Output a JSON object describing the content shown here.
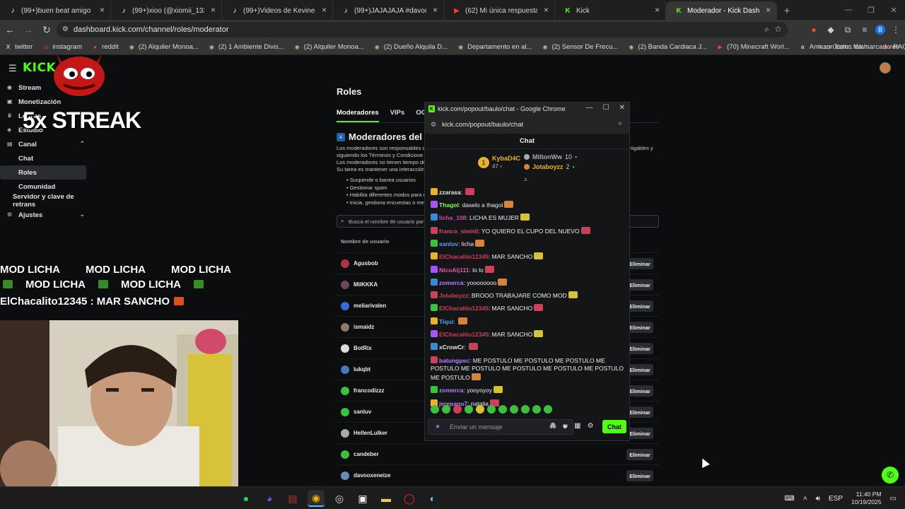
{
  "browser": {
    "tabs": [
      {
        "title": "(99+)buen beat amigo 💀 #bau",
        "icon": "tiktok-icon",
        "active": false
      },
      {
        "title": "(99+)xioo (@xiomii_133) | TikTo",
        "icon": "tiktok-icon",
        "active": false
      },
      {
        "title": "(99+)Videos de Kevine-seith (@",
        "icon": "tiktok-icon",
        "active": false
      },
      {
        "title": "(99+)JAJAJAJA #davooxeneize",
        "icon": "tiktok-icon",
        "active": false
      },
      {
        "title": "(62) Mi única respuesta a Matía",
        "icon": "youtube-icon",
        "active": false
      },
      {
        "title": "Kick",
        "icon": "kick-icon",
        "active": false
      },
      {
        "title": "Moderador - Kick Dashboard",
        "icon": "kick-icon",
        "active": true
      }
    ],
    "url": "dashboard.kick.com/channel/roles/moderator",
    "profile_letter": "B",
    "bookmarks": [
      {
        "label": "twitter",
        "icon": "x-icon"
      },
      {
        "label": "instagram",
        "icon": "instagram-icon"
      },
      {
        "label": "reddit",
        "icon": "reddit-icon"
      },
      {
        "label": "(2) Alquiler Monoa...",
        "icon": "marketplace-icon"
      },
      {
        "label": "(2) 1 Ambiente Divis...",
        "icon": "marketplace-icon"
      },
      {
        "label": "(2) Alquiler Monoa...",
        "icon": "marketplace-icon"
      },
      {
        "label": "(2) Dueño Alquila D...",
        "icon": "marketplace-icon"
      },
      {
        "label": "Departamento en al...",
        "icon": "marketplace-icon"
      },
      {
        "label": "(2) Sensor De Frecu...",
        "icon": "marketplace-icon"
      },
      {
        "label": "(2) Banda Cardiaca J...",
        "icon": "marketplace-icon"
      },
      {
        "label": "(70) Minecraft Worl...",
        "icon": "youtube-icon"
      },
      {
        "label": "Amazon.com : Wah...",
        "icon": "amazon-icon"
      },
      {
        "label": "RAG",
        "icon": "youtube-icon"
      }
    ],
    "all_bookmarks": "Todos los marcadores"
  },
  "kick": {
    "logo": "KICK",
    "sidebar": [
      {
        "label": "Stream",
        "icon": "stream-icon"
      },
      {
        "label": "Monetización",
        "icon": "monetization-icon"
      },
      {
        "label": "Logros",
        "icon": "trophy-icon"
      },
      {
        "label": "Estudio",
        "icon": "studio-icon"
      },
      {
        "label": "Canal",
        "icon": "channel-icon",
        "expanded": true
      }
    ],
    "sidebar_sub": [
      "Chat",
      "Roles",
      "Comunidad"
    ],
    "sidebar_extra": [
      "Servidor y clave de retrans"
    ],
    "sidebar_settings": "Ajustes",
    "roles_title": "Roles",
    "roles_tabs": [
      "Moderadores",
      "VIPs",
      "OGs"
    ],
    "mods_heading": "Moderadores del c",
    "desc_lines": [
      "Los moderadores son responsables d",
      "siguiendo los Términos y Condicione",
      "Los moderadores no tienen tiempo de",
      "Su tarea es mantener una interacción"
    ],
    "desc_right": "nigables y",
    "bullets": [
      "Suspende o banea usuarios",
      "Gestionar spam",
      "Habilita diferentes modos para e",
      "Inicia, gestiona encuestas o men"
    ],
    "search_placeholder": "Busca el nombre de usuario par",
    "col_username": "Nombre de usuario",
    "remove_label": "Eliminar",
    "moderators": [
      {
        "name": "Agusbob",
        "color": "#b3314a"
      },
      {
        "name": "MilKKKA",
        "color": "#6a4a5a"
      },
      {
        "name": "meliarivalen",
        "color": "#3a6ad8"
      },
      {
        "name": "ismaidz",
        "color": "#8a7a6a"
      },
      {
        "name": "BotRix",
        "color": "#dddddd"
      },
      {
        "name": "lukqbt",
        "color": "#4a78b8"
      },
      {
        "name": "francodizzz",
        "color": "#3fbf3f"
      },
      {
        "name": "sanluv",
        "color": "#3fbf3f"
      },
      {
        "name": "HellenLulker",
        "color": "#aaaaaa"
      },
      {
        "name": "candeber",
        "color": "#3fbf3f"
      },
      {
        "name": "davooxeneize",
        "color": "#6a8ab8"
      }
    ]
  },
  "stream_overlay": {
    "streak": "5x STREAK",
    "chat_lines": [
      [
        "MOD LICHA",
        "MOD LICHA",
        "MOD LICHA"
      ],
      [
        "MOD LICHA",
        "MOD LICHA"
      ]
    ],
    "last_line": "ElChacalito12345 : MAR SANCHO"
  },
  "popout": {
    "window_title": "kick.com/popout/baulo/chat - Google Chrome",
    "url": "kick.com/popout/baulo/chat",
    "chat_title": "Chat",
    "top_gifters": [
      {
        "name": "KybaD4C",
        "count": "47"
      },
      {
        "name": "MiltonWw",
        "count": "10"
      },
      {
        "name": "Jotaboyzz",
        "count": "2"
      }
    ],
    "messages": [
      {
        "user": "zzarasa",
        "color": "#e8e8e8",
        "text": ""
      },
      {
        "user": "Thagol",
        "color": "#7fff5a",
        "text": "daselo a thagol"
      },
      {
        "user": "licha_108",
        "color": "#d04aa8",
        "text": "LICHA ES MUJER"
      },
      {
        "user": "franco_steinli",
        "color": "#d04a6a",
        "text": "YO QUIERO EL CUPO DEL NUEVO"
      },
      {
        "user": "sanluv",
        "color": "#4aa3ff",
        "text": "licha"
      },
      {
        "user": "ElChacalito12345",
        "color": "#c8425a",
        "text": "MAR SANCHO"
      },
      {
        "user": "NicoAlj111",
        "color": "#e25aa8",
        "text": "lo lo"
      },
      {
        "user": "zomerca",
        "color": "#b084ff",
        "text": "yoooooooo"
      },
      {
        "user": "Jotaboyzz",
        "color": "#c8425a",
        "text": "BROOO TRABAJARE COMO MOD"
      },
      {
        "user": "ElChacalito12345",
        "color": "#c8425a",
        "text": "MAR SANCHO"
      },
      {
        "user": "Tiqui",
        "color": "#4aa3ff",
        "text": ""
      },
      {
        "user": "ElChacalito12345",
        "color": "#c8425a",
        "text": "MAR SANCHO"
      },
      {
        "user": "xCrowCr",
        "color": "#e8e8e8",
        "text": ""
      },
      {
        "user": "batungpsc",
        "color": "#b084ff",
        "text": "ME POSTULO ME POSTULO ME POSTULO ME POSTULO ME POSTULO ME POSTULO ME POSTULO ME POSTULO ME POSTULO"
      },
      {
        "user": "zomerca",
        "color": "#b084ff",
        "text": "yooyoyoy"
      },
      {
        "user": "jerepapu7",
        "color": "#b084ff",
        "text": "natalia"
      }
    ],
    "input_placeholder": "Enviar un mensaje",
    "send_label": "Chat"
  },
  "taskbar": {
    "apps": [
      "spotify-icon",
      "discord-icon",
      "winrar-icon",
      "chrome-icon",
      "obs-icon",
      "capcut-icon",
      "file-explorer-icon",
      "opera-gx-icon",
      "steam-icon"
    ],
    "language": "ESP",
    "time": "11:40 PM",
    "date": "10/19/2025"
  }
}
